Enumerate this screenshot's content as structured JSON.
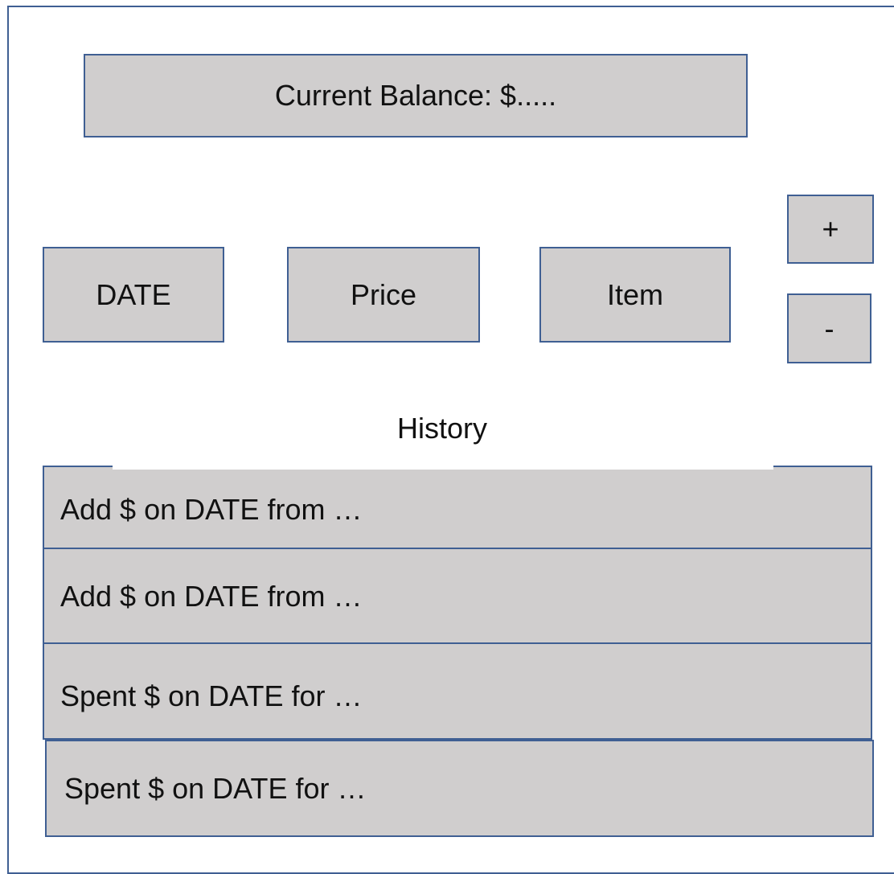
{
  "balance": {
    "label": "Current Balance: $....."
  },
  "inputs": {
    "date_label": "DATE",
    "price_label": "Price",
    "item_label": "Item"
  },
  "buttons": {
    "add_label": "+",
    "remove_label": "-"
  },
  "history": {
    "title": "History",
    "entries": [
      "Add $ on DATE from …",
      "Add $ on DATE from …",
      "Spent $ on DATE for …",
      "Spent $ on DATE for …"
    ]
  },
  "colors": {
    "box_fill": "#d0cece",
    "border": "#3f5f93",
    "background": "#ffffff"
  }
}
